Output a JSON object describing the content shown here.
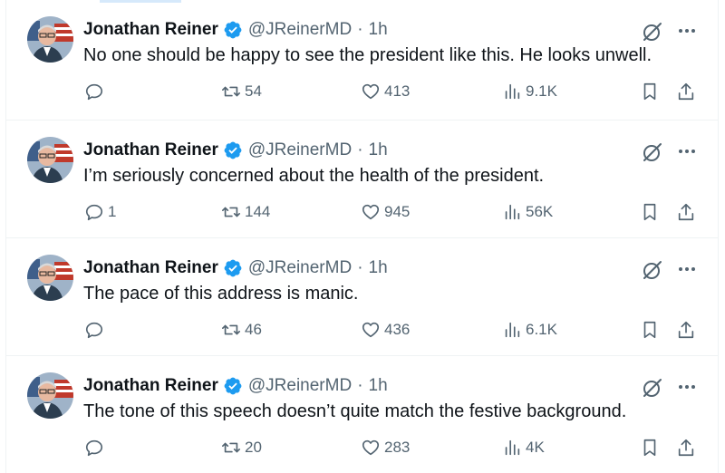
{
  "colors": {
    "text": "#0f1419",
    "secondary": "#536471",
    "verified": "#1d9bf0",
    "divider": "#eff3f4"
  },
  "author": {
    "name": "Jonathan Reiner",
    "handle": "@JReinerMD",
    "separator": "·"
  },
  "tweets": [
    {
      "time": "1h",
      "text": "No one should be happy to see the president like this. He looks unwell.",
      "replies": "",
      "retweets": "54",
      "likes": "413",
      "views": "9.1K"
    },
    {
      "time": "1h",
      "text": "I’m seriously concerned about the health of the president.",
      "replies": "1",
      "retweets": "144",
      "likes": "945",
      "views": "56K"
    },
    {
      "time": "1h",
      "text": "The pace of this address is manic.",
      "replies": "",
      "retweets": "46",
      "likes": "436",
      "views": "6.1K"
    },
    {
      "time": "1h",
      "text": "The tone of this speech doesn’t quite match the festive background.",
      "replies": "",
      "retweets": "20",
      "likes": "283",
      "views": "4K"
    }
  ]
}
